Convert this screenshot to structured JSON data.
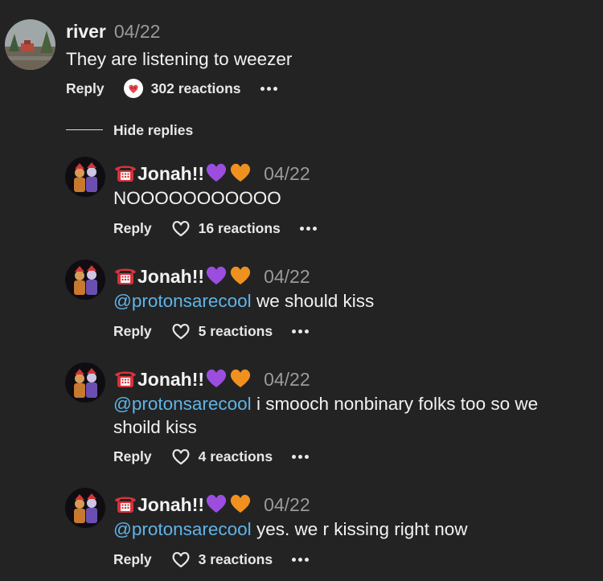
{
  "parent": {
    "username": "river",
    "date": "04/22",
    "text": "They are listening to weezer",
    "reply_label": "Reply",
    "reactions": "302 reactions",
    "reaction_icon": "heart-badge-icon"
  },
  "hide_replies": "Hide replies",
  "replies": [
    {
      "username": "Jonah!!",
      "date": "04/22",
      "mention": "",
      "text": "NOOOOOOOOOOO",
      "reply_label": "Reply",
      "reactions": "16 reactions"
    },
    {
      "username": "Jonah!!",
      "date": "04/22",
      "mention": "@protonsarecool",
      "text": " we should kiss",
      "reply_label": "Reply",
      "reactions": "5 reactions"
    },
    {
      "username": "Jonah!!",
      "date": "04/22",
      "mention": "@protonsarecool",
      "text": " i smooch nonbinary folks too so we shoild kiss",
      "reply_label": "Reply",
      "reactions": "4 reactions"
    },
    {
      "username": "Jonah!!",
      "date": "04/22",
      "mention": "@protonsarecool",
      "text": " yes. we r kissing right now",
      "reply_label": "Reply",
      "reactions": "3 reactions"
    }
  ],
  "colors": {
    "background": "#232323",
    "mention": "#5fb4e8",
    "purple_heart": "#9b4de0",
    "orange_heart": "#f0911f",
    "phone": "#d8323a"
  }
}
